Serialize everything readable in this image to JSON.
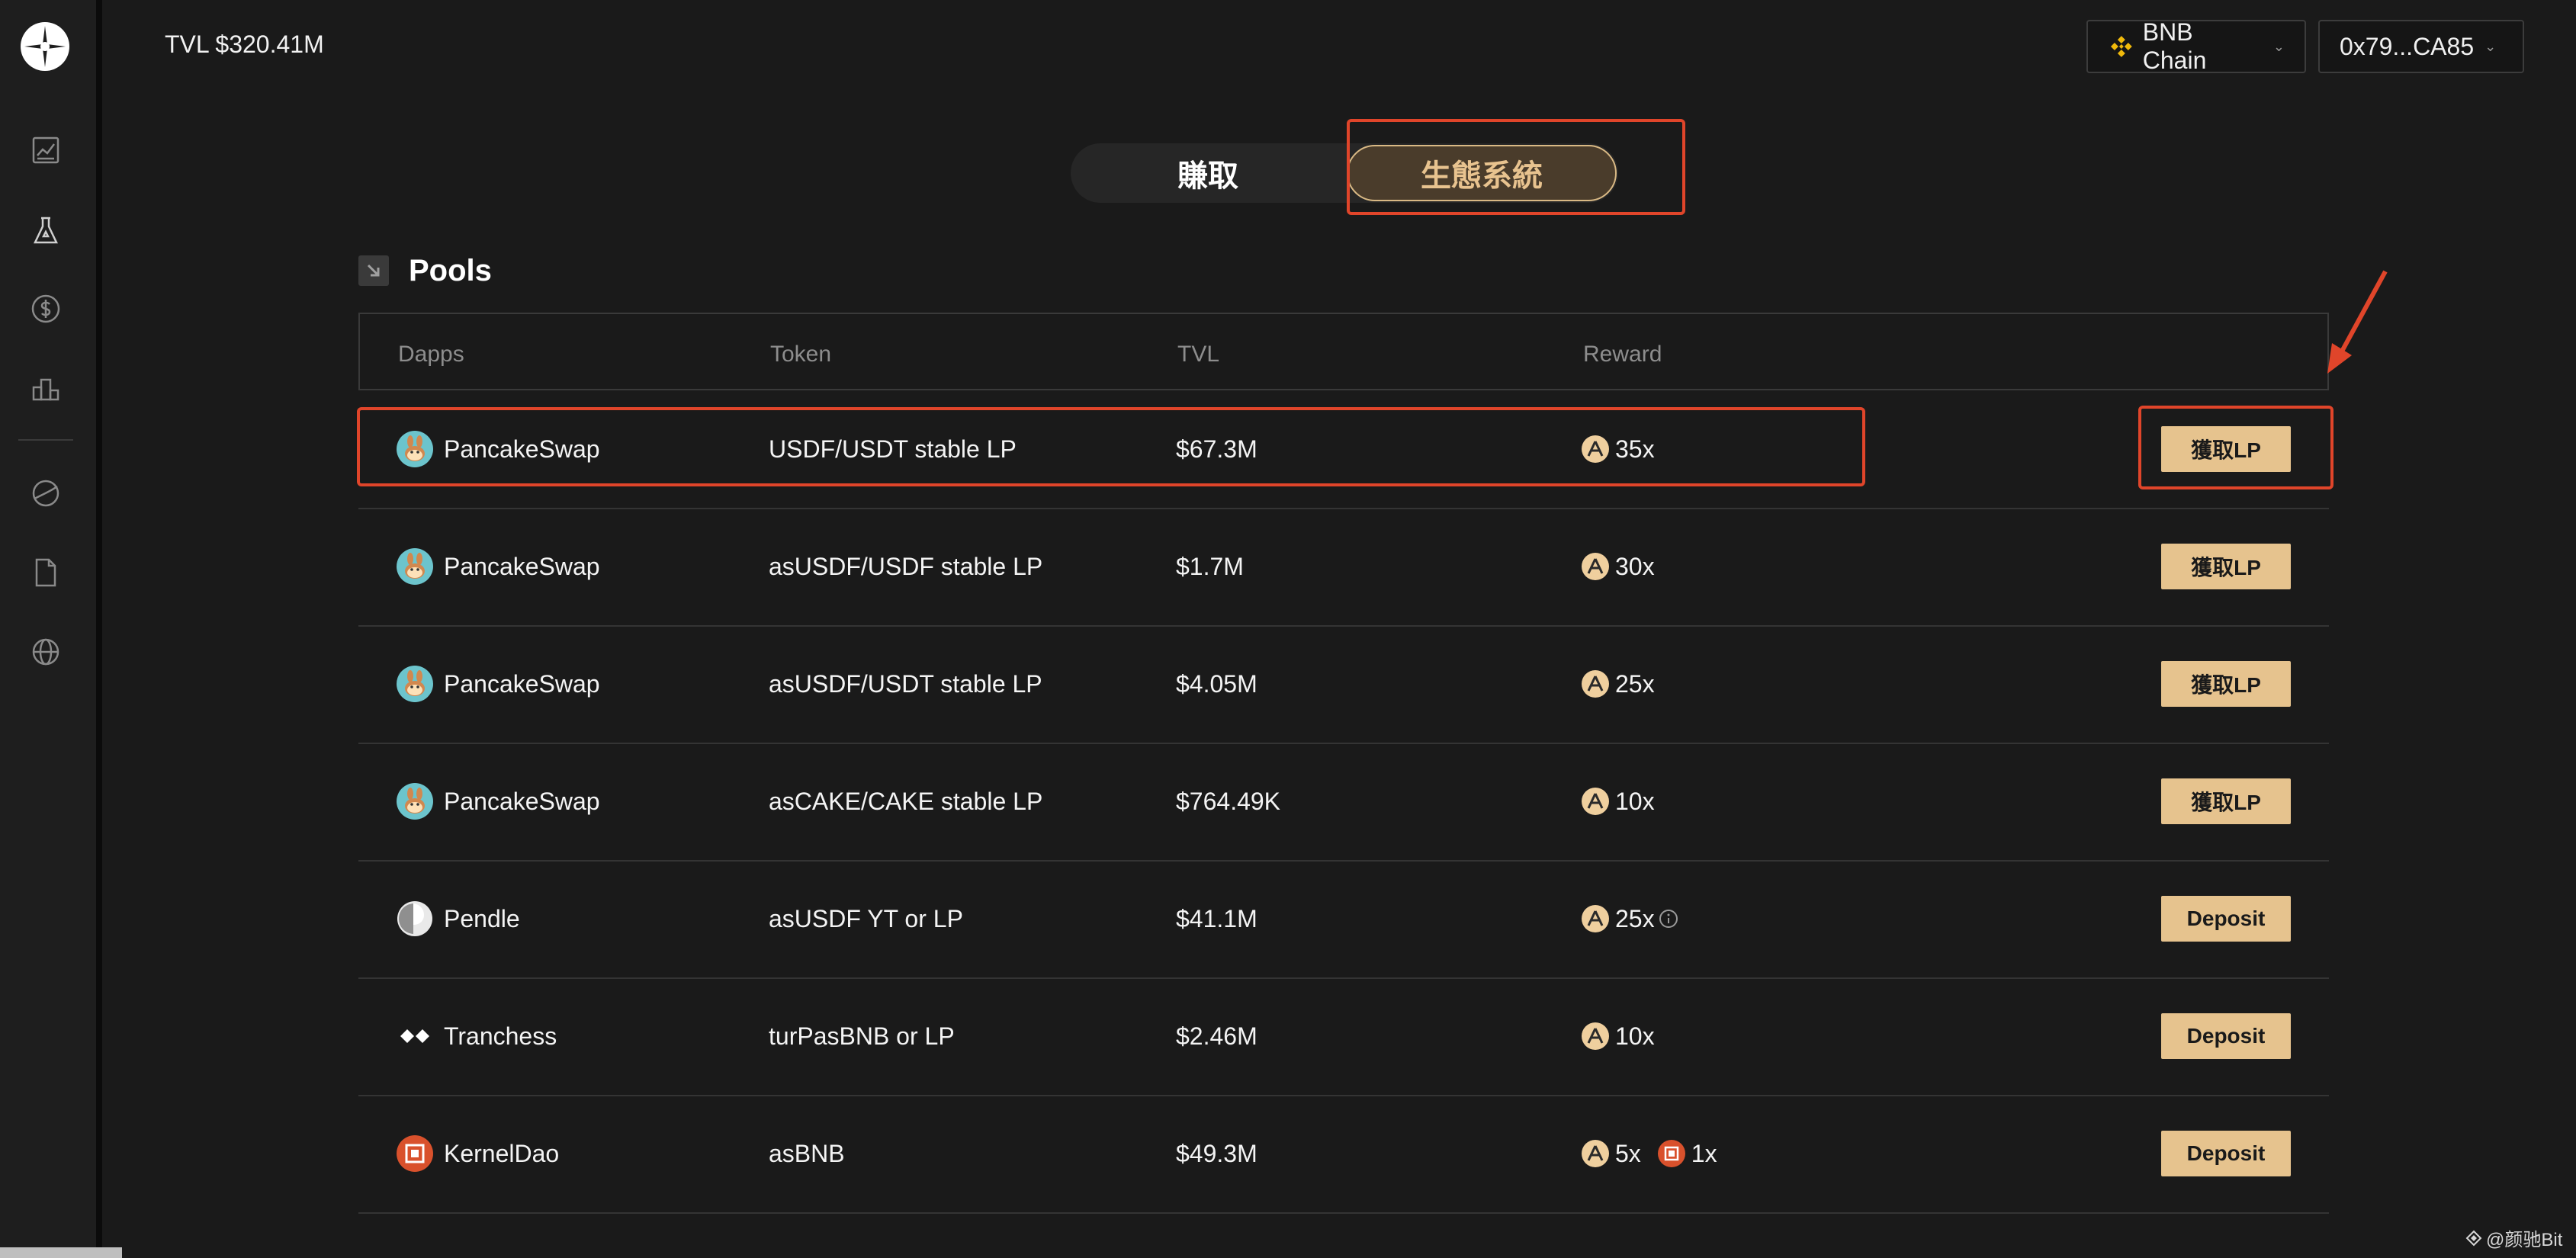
{
  "header": {
    "tvl": "TVL $320.41M",
    "chain": "BNB Chain",
    "wallet": "0x79...CA85"
  },
  "sidebar": {
    "items": [
      {
        "icon": "chart-icon"
      },
      {
        "icon": "flask-icon"
      },
      {
        "icon": "dollar-icon"
      },
      {
        "icon": "leaderboard-icon"
      },
      {
        "icon": "planet-icon"
      },
      {
        "icon": "document-icon"
      },
      {
        "icon": "globe-icon"
      }
    ]
  },
  "tabs": {
    "earn": "賺取",
    "ecosystem": "生態系統",
    "active": "ecosystem"
  },
  "pools": {
    "title": "Pools",
    "columns": {
      "dapps": "Dapps",
      "token": "Token",
      "tvl": "TVL",
      "reward": "Reward"
    },
    "rows": [
      {
        "dapp": "PancakeSwap",
        "token": "USDF/USDT stable LP",
        "tvl": "$67.3M",
        "reward": "35x",
        "action": "獲取LP"
      },
      {
        "dapp": "PancakeSwap",
        "token": "asUSDF/USDF stable LP",
        "tvl": "$1.7M",
        "reward": "30x",
        "action": "獲取LP"
      },
      {
        "dapp": "PancakeSwap",
        "token": "asUSDF/USDT stable LP",
        "tvl": "$4.05M",
        "reward": "25x",
        "action": "獲取LP"
      },
      {
        "dapp": "PancakeSwap",
        "token": "asCAKE/CAKE stable LP",
        "tvl": "$764.49K",
        "reward": "10x",
        "action": "獲取LP"
      },
      {
        "dapp": "Pendle",
        "token": "asUSDF YT or LP",
        "tvl": "$41.1M",
        "reward": "25x",
        "action": "Deposit"
      },
      {
        "dapp": "Tranchess",
        "token": "turPasBNB or LP",
        "tvl": "$2.46M",
        "reward": "10x",
        "action": "Deposit"
      },
      {
        "dapp": "KernelDao",
        "token": "asBNB",
        "tvl": "$49.3M",
        "reward": "5x",
        "reward2": "1x",
        "action": "Deposit"
      }
    ]
  },
  "watermark": "@颜驰Bit",
  "colors": {
    "accent": "#e6c38e",
    "highlight": "#e0452a",
    "background": "#1a1a1a"
  }
}
